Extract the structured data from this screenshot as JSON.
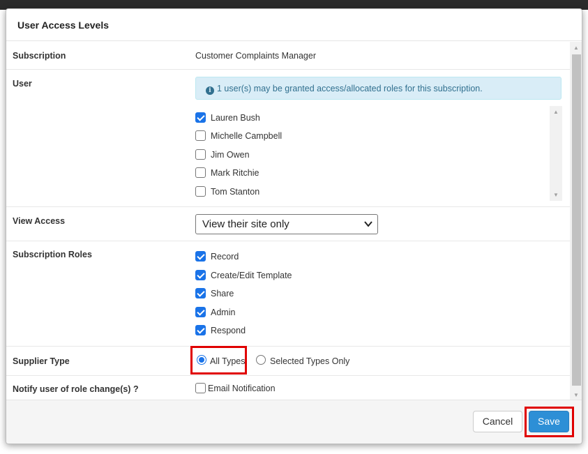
{
  "modal": {
    "title": "User Access Levels"
  },
  "subscription": {
    "label": "Subscription",
    "value": "Customer Complaints Manager"
  },
  "user": {
    "label": "User",
    "info_message": "1 user(s) may be granted access/allocated roles for this subscription.",
    "users": [
      {
        "name": "Lauren Bush",
        "checked": true
      },
      {
        "name": "Michelle Campbell",
        "checked": false
      },
      {
        "name": "Jim Owen",
        "checked": false
      },
      {
        "name": "Mark Ritchie",
        "checked": false
      },
      {
        "name": "Tom Stanton",
        "checked": false
      }
    ]
  },
  "view_access": {
    "label": "View Access",
    "selected": "View their site only"
  },
  "subscription_roles": {
    "label": "Subscription Roles",
    "roles": [
      {
        "name": "Record",
        "checked": true
      },
      {
        "name": "Create/Edit Template",
        "checked": true
      },
      {
        "name": "Share",
        "checked": true
      },
      {
        "name": "Admin",
        "checked": true
      },
      {
        "name": "Respond",
        "checked": true
      }
    ]
  },
  "supplier_type": {
    "label": "Supplier Type",
    "options": [
      {
        "label": "All Types",
        "selected": true
      },
      {
        "label": "Selected Types Only",
        "selected": false
      }
    ]
  },
  "notify": {
    "label": "Notify user of role change(s) ?",
    "option_label": "Email Notification",
    "checked": false
  },
  "footer": {
    "cancel_label": "Cancel",
    "save_label": "Save"
  },
  "colors": {
    "primary": "#2d8fd6",
    "checkbox": "#1a73e8",
    "info_bg": "#d9edf7",
    "info_text": "#31708f",
    "highlight": "#e00000"
  }
}
